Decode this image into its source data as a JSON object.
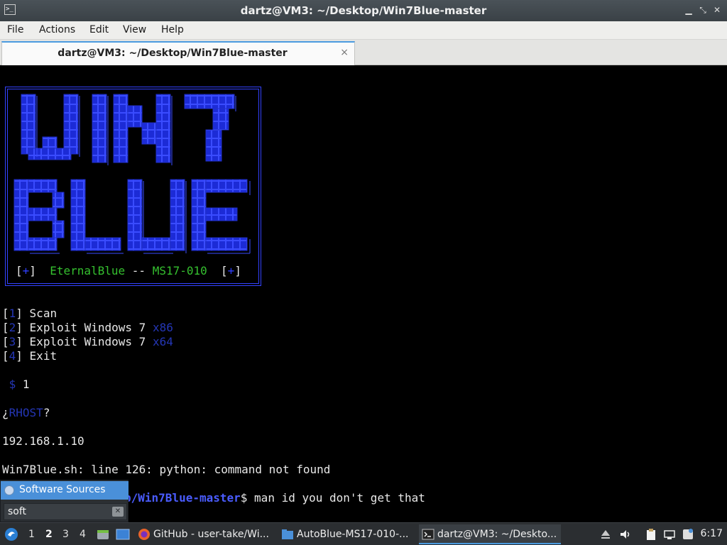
{
  "window": {
    "title": "dartz@VM3: ~/Desktop/Win7Blue-master",
    "app_icon": "terminal-icon"
  },
  "menu": {
    "items": [
      "File",
      "Actions",
      "Edit",
      "View",
      "Help"
    ]
  },
  "tab": {
    "title": "dartz@VM3: ~/Desktop/Win7Blue-master",
    "close": "×"
  },
  "terminal": {
    "banner_plus_left": "+",
    "banner_name": "EternalBlue",
    "banner_sep": "--",
    "banner_ms": "MS17-010",
    "banner_plus_right": "+",
    "menu_options": [
      {
        "num": "1",
        "label": "Scan",
        "arch": ""
      },
      {
        "num": "2",
        "label": "Exploit Windows 7",
        "arch": "x86"
      },
      {
        "num": "3",
        "label": "Exploit Windows 7",
        "arch": "x64"
      },
      {
        "num": "4",
        "label": "Exit",
        "arch": ""
      }
    ],
    "prompt_symbol": "$",
    "choice": "1",
    "rhost_open": "¿",
    "rhost_label": "RHOST",
    "rhost_close": "?",
    "ip": "192.168.1.10",
    "error": "Win7Blue.sh: line 126: python: command not found",
    "prompt_path_visible": "p/Win7Blue-master",
    "prompt_dollar": "$",
    "command": "man id you don't get that"
  },
  "launcher": {
    "item_label": "Software Sources",
    "search_value": "soft"
  },
  "taskbar": {
    "workspaces": [
      "1",
      "2",
      "3",
      "4"
    ],
    "active_workspace": "2",
    "tasks": [
      {
        "label": "GitHub - user-take/Wi...",
        "icon": "firefox-icon"
      },
      {
        "label": "AutoBlue-MS17-010-...",
        "icon": "folder-icon"
      },
      {
        "label": "dartz@VM3: ~/Deskto...",
        "icon": "terminal-icon"
      }
    ],
    "clock": "6:17"
  },
  "colors": {
    "accent": "#4b9be0",
    "terminal_blue": "#2f3fff",
    "terminal_green": "#35c02f"
  }
}
